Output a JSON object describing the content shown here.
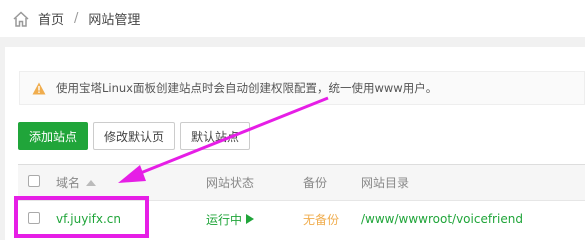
{
  "breadcrumb": {
    "home": "首页",
    "separator": "/",
    "current": "网站管理"
  },
  "alert": {
    "text": "使用宝塔Linux面板创建站点时会自动创建权限配置，统一使用www用户。"
  },
  "toolbar": {
    "add_site_label": "添加站点",
    "edit_default_page_label": "修改默认页",
    "default_site_label": "默认站点"
  },
  "table": {
    "headers": {
      "domain": "域名",
      "status": "网站状态",
      "backup": "备份",
      "path": "网站目录"
    },
    "rows": [
      {
        "domain": "vf.juyifx.cn",
        "status": "运行中",
        "backup": "无备份",
        "path": "/www/wwwroot/voicefriend"
      }
    ]
  },
  "colors": {
    "brand_green": "#20a53a",
    "annotation_magenta": "#e61ee6",
    "warning_orange": "#f0ad4e"
  },
  "icons": [
    "home-icon",
    "warning-icon",
    "sort-asc-icon",
    "play-icon"
  ]
}
